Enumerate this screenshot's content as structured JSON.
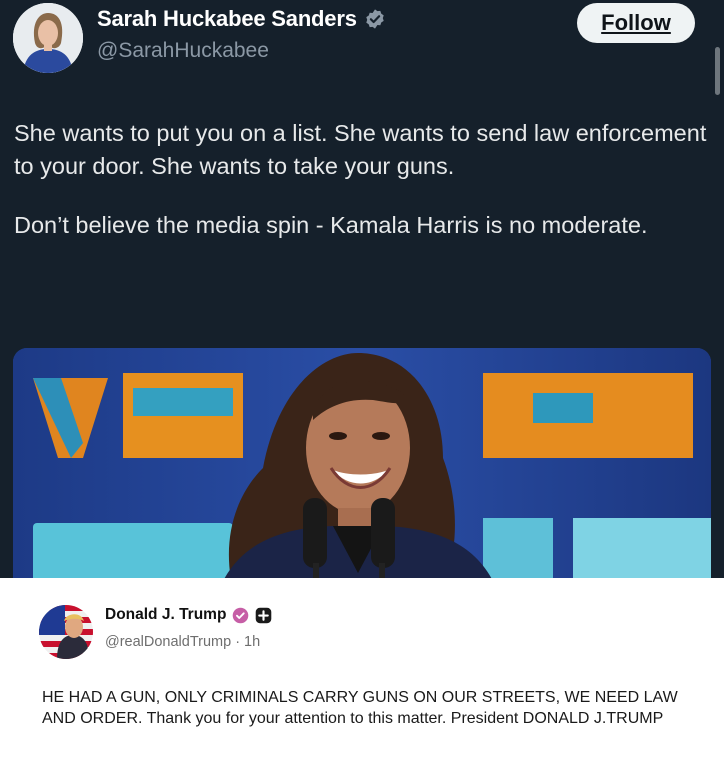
{
  "tweet": {
    "display_name": "Sarah Huckabee Sanders",
    "handle": "@SarahHuckabee",
    "follow_label": "Follow",
    "paragraphs": [
      "She wants to put you on a list. She wants to send law enforcement to your door. She wants to take your guns.",
      "Don’t believe the media spin - Kamala Harris is no moderate."
    ],
    "verified_color": "#8b98a5"
  },
  "embedded_post": {
    "display_name": "Donald J. Trump",
    "handle": "@realDonaldTrump",
    "separator": "·",
    "time": "1h",
    "text": "HE HAD A GUN, ONLY CRIMINALS CARRY GUNS ON OUR STREETS, WE NEED LAW AND ORDER. Thank you for your attention to this matter. President DONALD J.TRUMP",
    "badge_color": "#c65ea6"
  }
}
